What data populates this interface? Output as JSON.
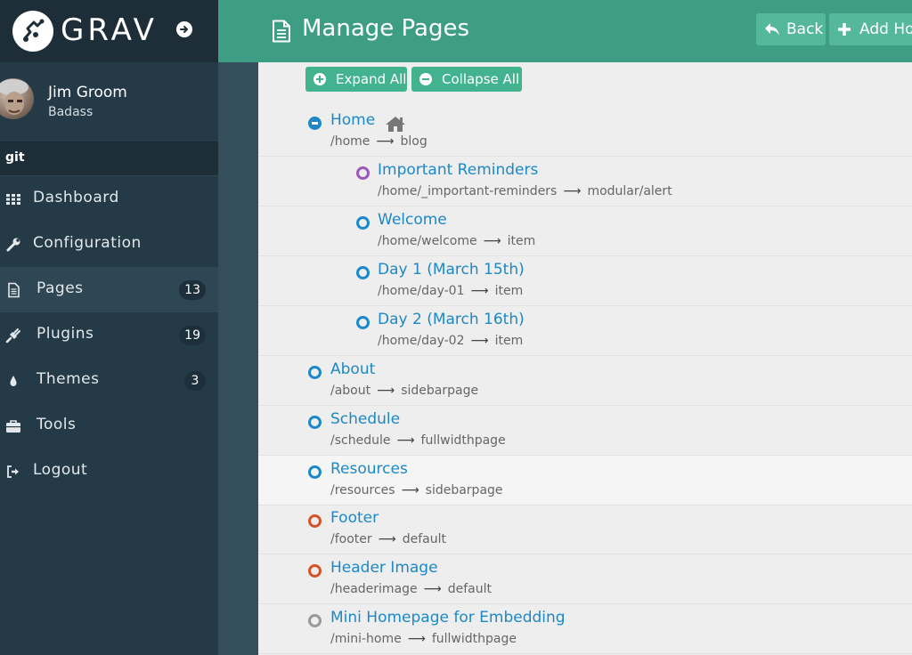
{
  "brand": {
    "name": "GRAV"
  },
  "user": {
    "name": "Jim Groom",
    "role": "Badass"
  },
  "git_label": "git",
  "nav": [
    {
      "label": "Dashboard",
      "icon": "grid-icon",
      "badge": ""
    },
    {
      "label": "Configuration",
      "icon": "wrench-icon",
      "badge": ""
    },
    {
      "label": "Pages",
      "icon": "file-icon",
      "badge": "13",
      "active": true
    },
    {
      "label": "Plugins",
      "icon": "plug-icon",
      "badge": "19"
    },
    {
      "label": "Themes",
      "icon": "tint-icon",
      "badge": "3"
    },
    {
      "label": "Tools",
      "icon": "briefcase-icon",
      "badge": ""
    },
    {
      "label": "Logout",
      "icon": "sign-out-icon",
      "badge": ""
    }
  ],
  "header": {
    "title": "Manage Pages",
    "back_label": "Back",
    "add_label": "Add Hom"
  },
  "toolbar": {
    "expand_all": "Expand All",
    "collapse_all": "Collapse All"
  },
  "pages": [
    {
      "title": "Home",
      "route": "/home",
      "template": "blog",
      "status": "expanded"
    },
    {
      "title": "Important Reminders",
      "route": "/home/_important-reminders",
      "template": "modular/alert",
      "status": "modular"
    },
    {
      "title": "Welcome",
      "route": "/home/welcome",
      "template": "item",
      "status": "published"
    },
    {
      "title": "Day 1 (March 15th)",
      "route": "/home/day-01",
      "template": "item",
      "status": "published"
    },
    {
      "title": "Day 2 (March 16th)",
      "route": "/home/day-02",
      "template": "item",
      "status": "published"
    },
    {
      "title": "About",
      "route": "/about",
      "template": "sidebarpage",
      "status": "published"
    },
    {
      "title": "Schedule",
      "route": "/schedule",
      "template": "fullwidthpage",
      "status": "published"
    },
    {
      "title": "Resources",
      "route": "/resources",
      "template": "sidebarpage",
      "status": "published"
    },
    {
      "title": "Footer",
      "route": "/footer",
      "template": "default",
      "status": "non-routable"
    },
    {
      "title": "Header Image",
      "route": "/headerimage",
      "template": "default",
      "status": "non-routable"
    },
    {
      "title": "Mini Homepage for Embedding",
      "route": "/mini-home",
      "template": "fullwidthpage",
      "status": "unpublished"
    }
  ],
  "colors": {
    "published": "#1c88c7",
    "modular": "#9b59b6",
    "non-routable": "#d5532b",
    "unpublished": "#999999"
  }
}
